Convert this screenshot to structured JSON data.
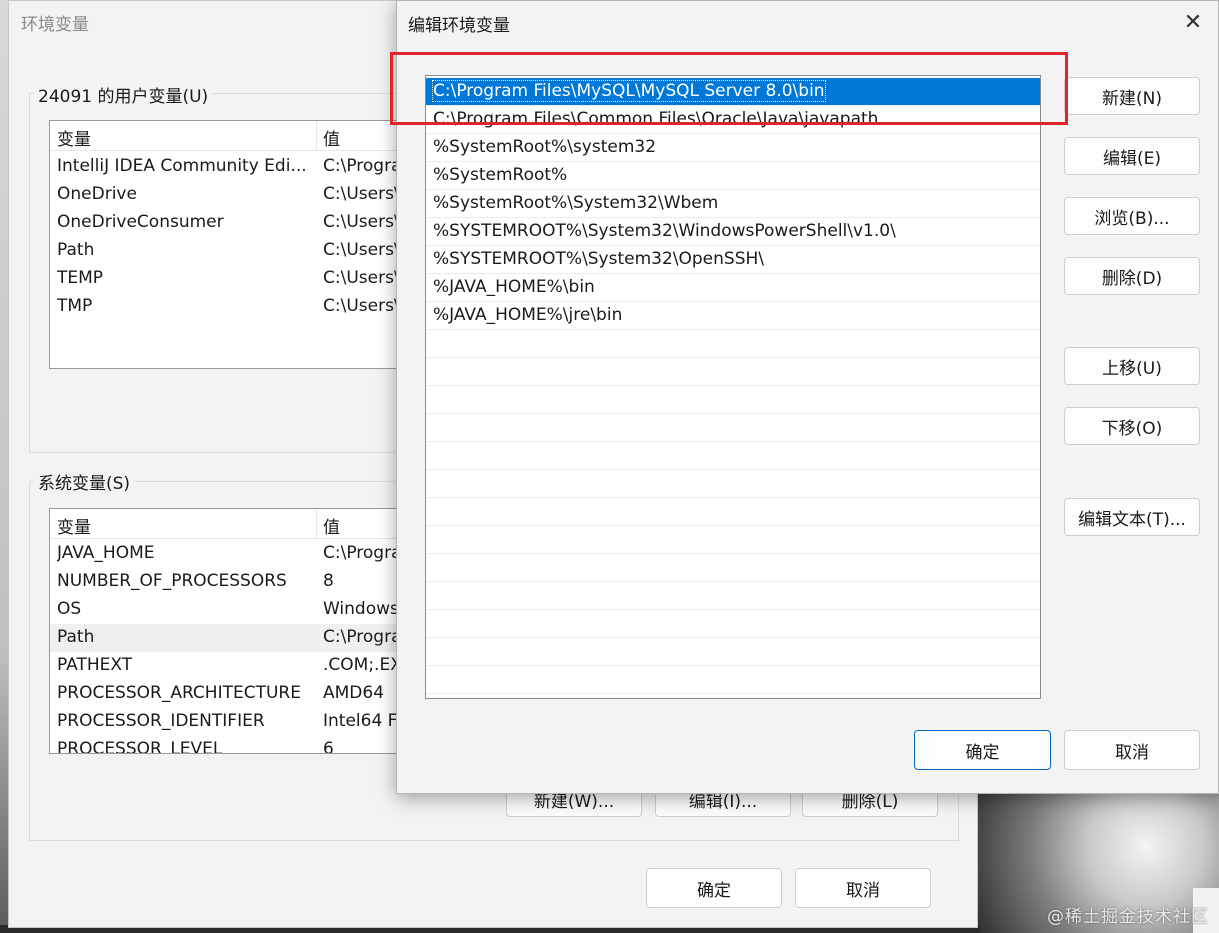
{
  "back": {
    "title": "环境变量",
    "user_section": "24091 的用户变量(U)",
    "system_section": "系统变量(S)",
    "col_var": "变量",
    "col_val": "值",
    "user_vars": [
      {
        "name": "IntelliJ IDEA Community Edi...",
        "value": "C:\\Progra"
      },
      {
        "name": "OneDrive",
        "value": "C:\\Users\\"
      },
      {
        "name": "OneDriveConsumer",
        "value": "C:\\Users\\"
      },
      {
        "name": "Path",
        "value": "C:\\Users\\"
      },
      {
        "name": "TEMP",
        "value": "C:\\Users\\"
      },
      {
        "name": "TMP",
        "value": "C:\\Users\\"
      }
    ],
    "system_vars": [
      {
        "name": "JAVA_HOME",
        "value": "C:\\Progra"
      },
      {
        "name": "NUMBER_OF_PROCESSORS",
        "value": "8"
      },
      {
        "name": "OS",
        "value": "Windows"
      },
      {
        "name": "Path",
        "value": "C:\\Progra"
      },
      {
        "name": "PATHEXT",
        "value": ".COM;.EX"
      },
      {
        "name": "PROCESSOR_ARCHITECTURE",
        "value": "AMD64"
      },
      {
        "name": "PROCESSOR_IDENTIFIER",
        "value": "Intel64 F"
      },
      {
        "name": "PROCESSOR_LEVEL",
        "value": "6"
      }
    ],
    "sys_buttons": {
      "new": "新建(W)...",
      "edit": "编辑(I)...",
      "delete": "删除(L)"
    },
    "ok": "确定",
    "cancel": "取消"
  },
  "front": {
    "title": "编辑环境变量",
    "paths": [
      "C:\\Program Files\\MySQL\\MySQL Server 8.0\\bin",
      "C:\\Program Files\\Common Files\\Oracle\\Java\\javapath",
      "%SystemRoot%\\system32",
      "%SystemRoot%",
      "%SystemRoot%\\System32\\Wbem",
      "%SYSTEMROOT%\\System32\\WindowsPowerShell\\v1.0\\",
      "%SYSTEMROOT%\\System32\\OpenSSH\\",
      "%JAVA_HOME%\\bin",
      "%JAVA_HOME%\\jre\\bin"
    ],
    "buttons": {
      "new": "新建(N)",
      "edit": "编辑(E)",
      "browse": "浏览(B)...",
      "delete": "删除(D)",
      "move_up": "上移(U)",
      "move_down": "下移(O)",
      "edit_text": "编辑文本(T)..."
    },
    "ok": "确定",
    "cancel": "取消"
  },
  "watermark": "@稀土掘金技术社区",
  "colors": {
    "selection": "#0078d7",
    "highlight_box": "#e0242b",
    "primary_border": "#0067c0"
  }
}
